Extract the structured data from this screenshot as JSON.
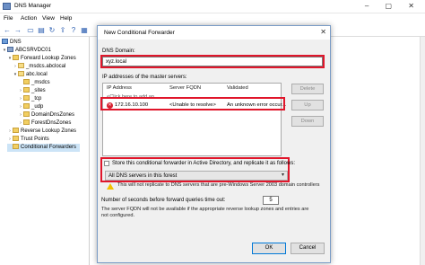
{
  "app": {
    "title": "DNS Manager",
    "menu": [
      "File",
      "Action",
      "View",
      "Help"
    ]
  },
  "tree": {
    "items": [
      {
        "label": "DNS",
        "level": 0,
        "icon": "dns-icon",
        "expander": ""
      },
      {
        "label": "ABCSRVDC01",
        "level": 1,
        "icon": "server-icon",
        "expander": "▾"
      },
      {
        "label": "Forward Lookup Zones",
        "level": 2,
        "icon": "folder-icon",
        "expander": "▾"
      },
      {
        "label": "_msdcs.abclocal",
        "level": 3,
        "icon": "zone-icon",
        "expander": "›"
      },
      {
        "label": "abc.local",
        "level": 3,
        "icon": "zone-icon",
        "expander": "▾"
      },
      {
        "label": "_msdcs",
        "level": 4,
        "icon": "folder-icon",
        "expander": ""
      },
      {
        "label": "_sites",
        "level": 4,
        "icon": "folder-icon",
        "expander": "›"
      },
      {
        "label": "_tcp",
        "level": 4,
        "icon": "folder-icon",
        "expander": "›"
      },
      {
        "label": "_udp",
        "level": 4,
        "icon": "folder-icon",
        "expander": "›"
      },
      {
        "label": "DomainDnsZones",
        "level": 4,
        "icon": "folder-icon",
        "expander": "›"
      },
      {
        "label": "ForestDnsZones",
        "level": 4,
        "icon": "folder-icon",
        "expander": "›"
      },
      {
        "label": "Reverse Lookup Zones",
        "level": 2,
        "icon": "folder-icon",
        "expander": "›"
      },
      {
        "label": "Trust Points",
        "level": 2,
        "icon": "folder-icon",
        "expander": "›"
      },
      {
        "label": "Conditional Forwarders",
        "level": 2,
        "icon": "folder-icon",
        "expander": "",
        "selected": true
      }
    ]
  },
  "dialog": {
    "title": "New Conditional Forwarder",
    "close_glyph": "✕",
    "domain_label": "DNS Domain:",
    "domain_value": "xyz.local",
    "ip_label": "IP addresses of the master servers:",
    "grid_headers": {
      "ip": "IP Address",
      "fqdn": "Server FQDN",
      "validated": "Validated"
    },
    "grid_placeholder": "<Click here to add an ...",
    "grid_row": {
      "ip": "172.16.10.100",
      "fqdn": "<Unable to resolve>",
      "validated": "An unknown error occur...",
      "status_icon": "error-icon"
    },
    "buttons_side": {
      "delete": "Delete",
      "up": "Up",
      "down": "Down"
    },
    "store_label": "Store this conditional forwarder in Active Directory, and replicate it as follows:",
    "replicate_value": "All DNS servers in this forest",
    "warning_text": "This will not replicate to DNS servers that are pre-Windows Server 2003 domain controllers",
    "timeout_label": "Number of seconds before forward queries time out:",
    "timeout_value": "5",
    "fqdn_note": "The server FQDN will not be available if the appropriate reverse lookup zones and entries are not configured.",
    "ok": "OK",
    "cancel": "Cancel"
  },
  "colors": {
    "highlight_red": "#e0162b",
    "selection": "#cce4f7",
    "error_red": "#d7202f"
  }
}
